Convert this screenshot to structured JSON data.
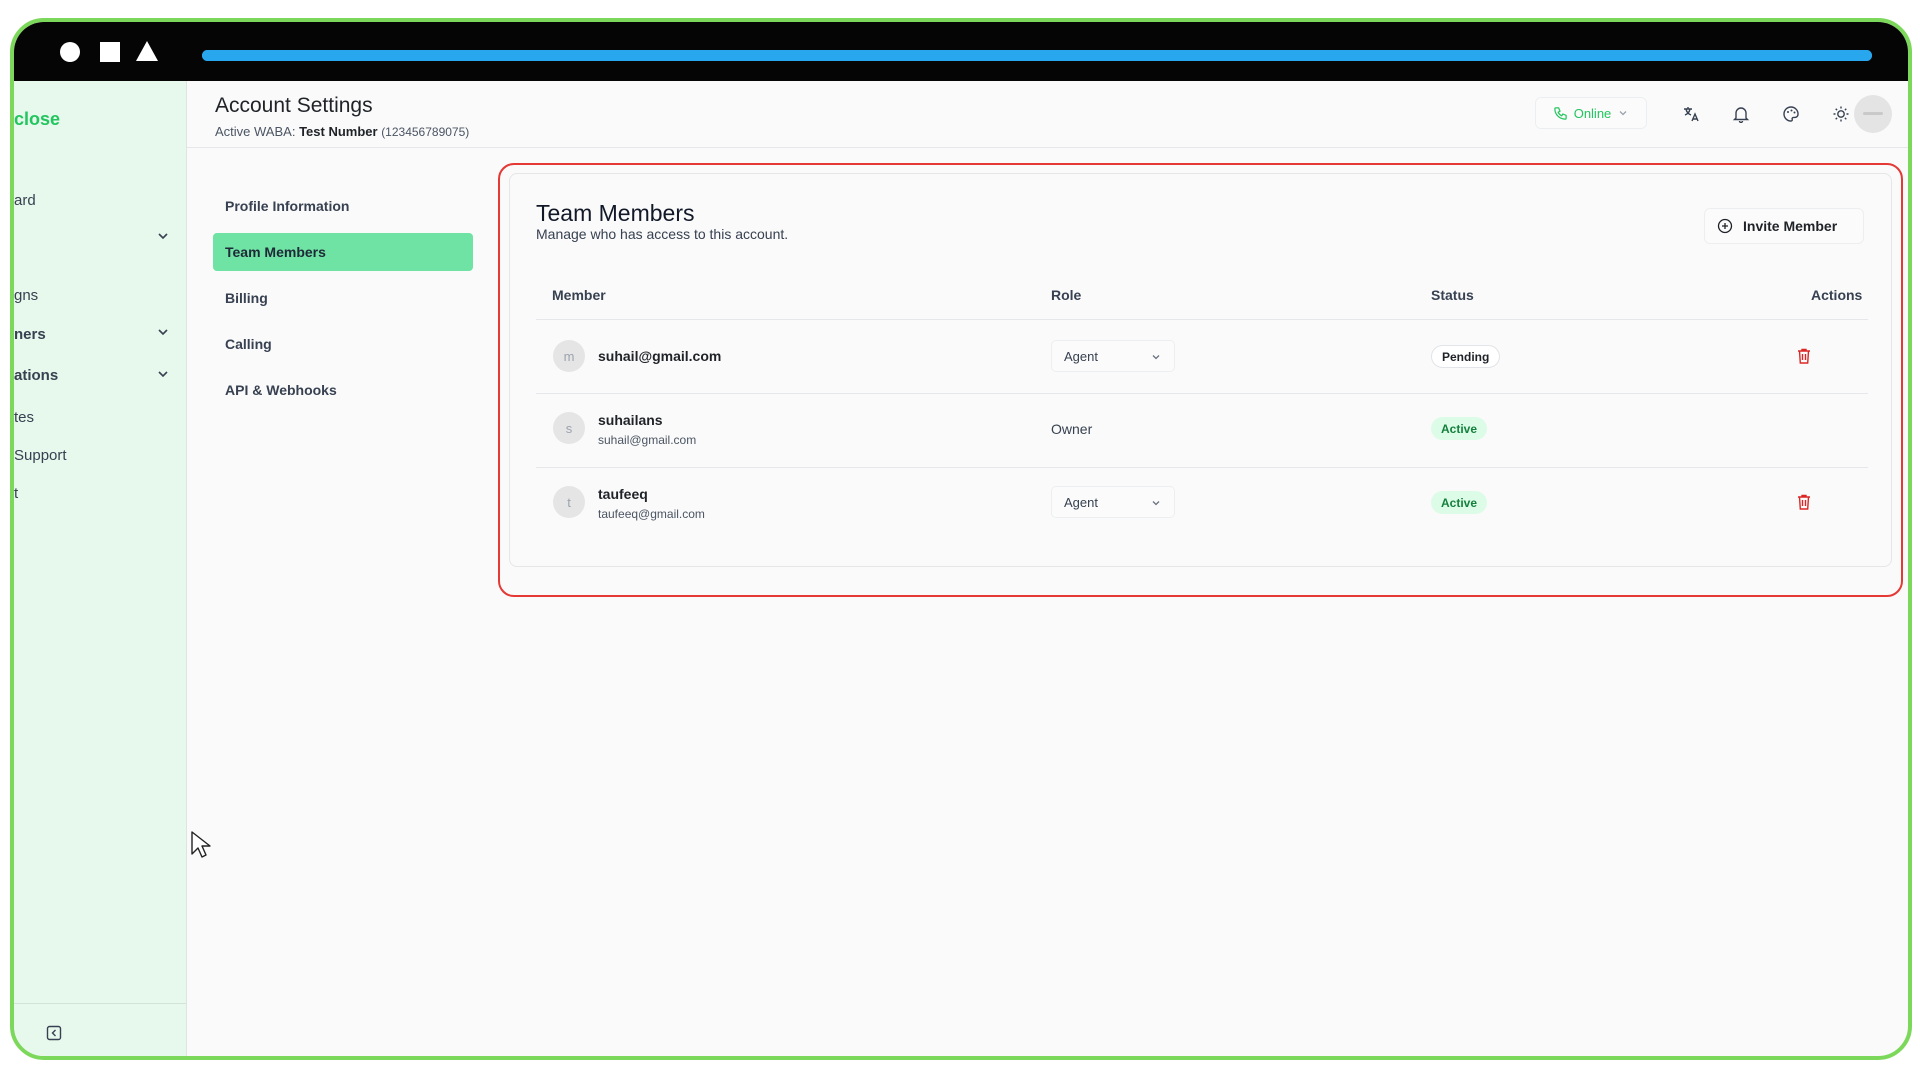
{
  "window": {
    "progress_pct": 100,
    "accent_color": "#28a6ee"
  },
  "sidebar": {
    "logo_partial": "close",
    "items": [
      {
        "label": "ard",
        "has_chevron": false
      },
      {
        "label": "",
        "has_chevron": true
      },
      {
        "label": "gns",
        "has_chevron": false
      },
      {
        "label": "ners",
        "has_chevron": true
      },
      {
        "label": "ations",
        "has_chevron": true
      },
      {
        "label": "tes",
        "has_chevron": false
      },
      {
        "label": "Support",
        "has_chevron": false
      },
      {
        "label": "t",
        "has_chevron": false
      }
    ],
    "collapse_icon": "collapse-sidebar-icon"
  },
  "header": {
    "title": "Account Settings",
    "waba_label": "Active WABA:",
    "waba_name": "Test Number",
    "waba_number": "(123456789075)",
    "status_button": "Online",
    "icons": [
      "translate-icon",
      "bell-icon",
      "palette-icon",
      "sun-icon",
      "avatar"
    ]
  },
  "subnav": {
    "items": [
      {
        "label": "Profile Information",
        "active": false
      },
      {
        "label": "Team Members",
        "active": true
      },
      {
        "label": "Billing",
        "active": false
      },
      {
        "label": "Calling",
        "active": false
      },
      {
        "label": "API & Webhooks",
        "active": false
      }
    ]
  },
  "team": {
    "title": "Team Members",
    "subtitle": "Manage who has access to this account.",
    "invite_label": "Invite Member",
    "columns": {
      "member": "Member",
      "role": "Role",
      "status": "Status",
      "actions": "Actions"
    },
    "rows": [
      {
        "initial": "m",
        "name": "suhail@gmail.com",
        "email": "",
        "role": "Agent",
        "role_editable": true,
        "status": "Pending",
        "deletable": true
      },
      {
        "initial": "s",
        "name": "suhailans",
        "email": "suhail@gmail.com",
        "role": "Owner",
        "role_editable": false,
        "status": "Active",
        "deletable": false
      },
      {
        "initial": "t",
        "name": "taufeeq",
        "email": "taufeeq@gmail.com",
        "role": "Agent",
        "role_editable": true,
        "status": "Active",
        "deletable": true
      }
    ]
  }
}
